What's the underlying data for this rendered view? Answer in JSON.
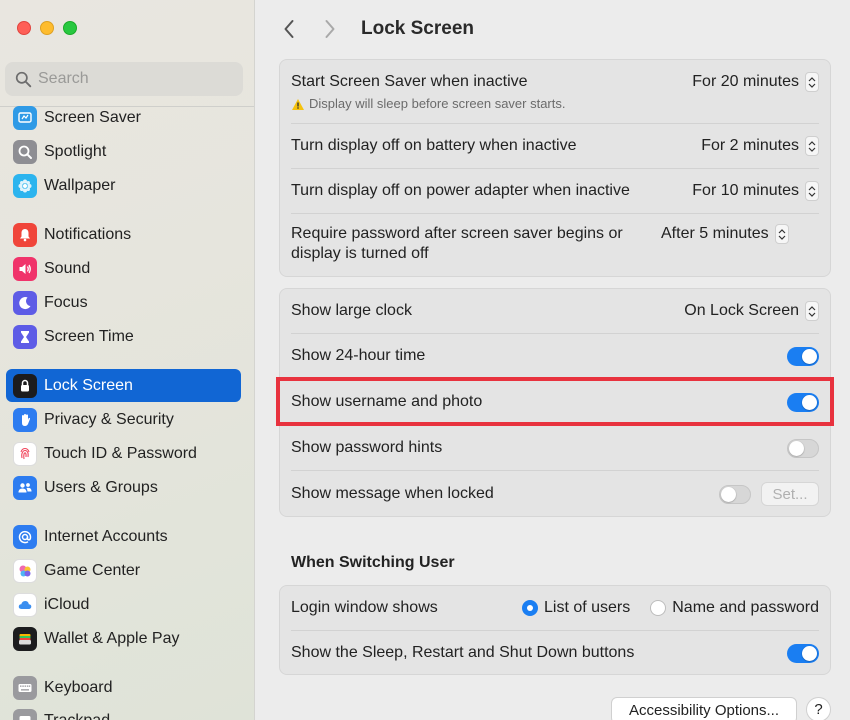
{
  "sidebar": {
    "search_placeholder": "Search",
    "items": [
      {
        "label": "Screen Saver",
        "icon": "screen-saver-icon",
        "color": "#2f9ae6"
      },
      {
        "label": "Spotlight",
        "icon": "spotlight-icon",
        "color": "#8e8e93"
      },
      {
        "label": "Wallpaper",
        "icon": "wallpaper-icon",
        "color": "#2cb4ee"
      },
      {
        "label": "Notifications",
        "icon": "notifications-icon",
        "color": "#f0453a"
      },
      {
        "label": "Sound",
        "icon": "sound-icon",
        "color": "#f0336a"
      },
      {
        "label": "Focus",
        "icon": "focus-icon",
        "color": "#5e5ce6"
      },
      {
        "label": "Screen Time",
        "icon": "screen-time-icon",
        "color": "#5e5ce6"
      },
      {
        "label": "Lock Screen",
        "icon": "lock-icon",
        "color": "#1c1c1e",
        "active": true
      },
      {
        "label": "Privacy & Security",
        "icon": "hand-icon",
        "color": "#2d7cf0"
      },
      {
        "label": "Touch ID & Password",
        "icon": "fingerprint-icon",
        "color": "#ffffff"
      },
      {
        "label": "Users & Groups",
        "icon": "users-icon",
        "color": "#2d7cf0"
      },
      {
        "label": "Internet Accounts",
        "icon": "at-icon",
        "color": "#2d7cf0"
      },
      {
        "label": "Game Center",
        "icon": "game-center-icon",
        "color": "#ffffff"
      },
      {
        "label": "iCloud",
        "icon": "icloud-icon",
        "color": "#ffffff"
      },
      {
        "label": "Wallet & Apple Pay",
        "icon": "wallet-icon",
        "color": "#1c1c1e"
      },
      {
        "label": "Keyboard",
        "icon": "keyboard-icon",
        "color": "#9a9a9e"
      },
      {
        "label": "Trackpad",
        "icon": "trackpad-icon",
        "color": "#9a9a9e"
      }
    ]
  },
  "header": {
    "title": "Lock Screen"
  },
  "group1": {
    "screen_saver": {
      "label": "Start Screen Saver when inactive",
      "value": "For 20 minutes",
      "warning": "Display will sleep before screen saver starts."
    },
    "battery": {
      "label": "Turn display off on battery when inactive",
      "value": "For 2 minutes"
    },
    "power": {
      "label": "Turn display off on power adapter when inactive",
      "value": "For 10 minutes"
    },
    "password": {
      "label": "Require password after screen saver begins or display is turned off",
      "value": "After 5 minutes"
    }
  },
  "group2": {
    "large_clock": {
      "label": "Show large clock",
      "value": "On Lock Screen"
    },
    "time24": {
      "label": "Show 24-hour time",
      "on": true
    },
    "username": {
      "label": "Show username and photo",
      "on": true
    },
    "hints": {
      "label": "Show password hints",
      "on": false
    },
    "message": {
      "label": "Show message when locked",
      "on": false,
      "set_label": "Set..."
    }
  },
  "switching": {
    "title": "When Switching User",
    "login_label": "Login window shows",
    "option_list": "List of users",
    "option_name": "Name and password",
    "selected": "List of users",
    "buttons_label": "Show the Sleep, Restart and Shut Down buttons",
    "buttons_on": true
  },
  "footer": {
    "accessibility": "Accessibility Options...",
    "help": "?"
  },
  "colors": {
    "accent": "#1a7ef2",
    "sidebar_selected": "#1166d4",
    "highlight": "#e8323e"
  }
}
